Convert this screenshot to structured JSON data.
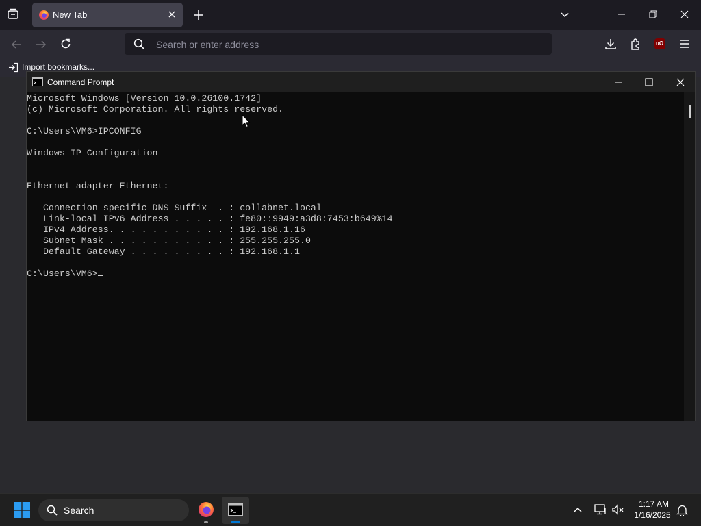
{
  "browser": {
    "tab_title": "New Tab",
    "address_placeholder": "Search or enter address",
    "bookmarks_import_label": "Import bookmarks...",
    "extension_badge": "uO",
    "colors": {
      "tabstrip": "#1c1b22",
      "toolbar": "#2b2a33",
      "tab_active": "#42414d",
      "urlbar": "#1c1b22"
    }
  },
  "cmd_window": {
    "title": "Command Prompt",
    "lines": [
      "Microsoft Windows [Version 10.0.26100.1742]",
      "(c) Microsoft Corporation. All rights reserved.",
      "",
      "C:\\Users\\VM6>IPCONFIG",
      "",
      "Windows IP Configuration",
      "",
      "",
      "Ethernet adapter Ethernet:",
      "",
      "   Connection-specific DNS Suffix  . : collabnet.local",
      "   Link-local IPv6 Address . . . . . : fe80::9949:a3d8:7453:b649%14",
      "   IPv4 Address. . . . . . . . . . . : 192.168.1.16",
      "   Subnet Mask . . . . . . . . . . . : 255.255.255.0",
      "   Default Gateway . . . . . . . . . : 192.168.1.1",
      ""
    ],
    "prompt": "C:\\Users\\VM6>",
    "colors": {
      "background": "#0c0c0c",
      "text": "#cccccc",
      "titlebar": "#1f1f1f"
    }
  },
  "taskbar": {
    "search_label": "Search",
    "clock_time": "1:17 AM",
    "clock_date": "1/16/2025",
    "colors": {
      "background": "#202020",
      "accent": "#0078d4"
    }
  },
  "icons": [
    "tab-list-icon",
    "firefox-icon",
    "close-tab-icon",
    "new-tab-icon",
    "list-all-tabs-icon",
    "minimize-icon",
    "restore-icon",
    "close-icon",
    "back-icon",
    "forward-icon",
    "reload-icon",
    "search-icon",
    "downloads-icon",
    "extensions-icon",
    "ublock-icon",
    "menu-icon",
    "import-icon",
    "cmd-icon",
    "maximize-icon",
    "windows-start-icon",
    "show-hidden-icons-icon",
    "network-icon",
    "volume-muted-icon",
    "notification-bell-icon",
    "mouse-cursor-icon"
  ]
}
